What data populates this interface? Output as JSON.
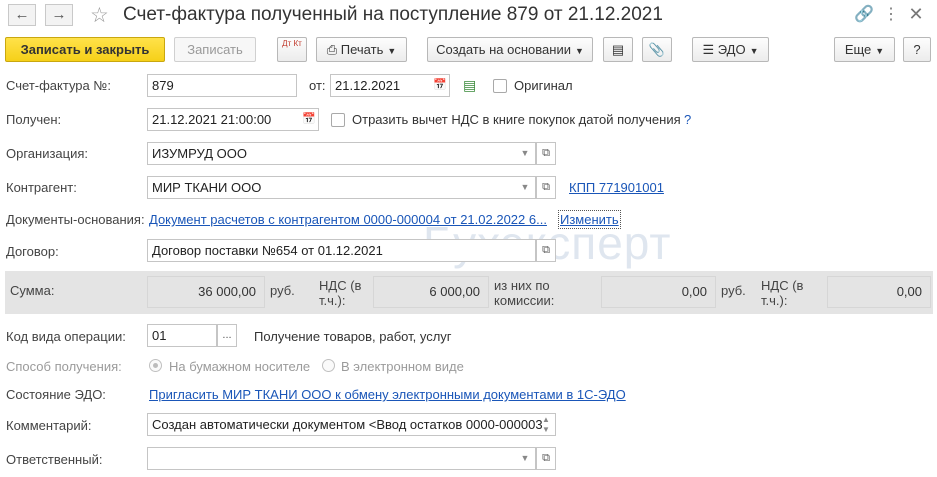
{
  "window": {
    "title": "Счет-фактура полученный на поступление 879 от 21.12.2021",
    "icons": [
      "back-arrow-icon",
      "forward-arrow-icon",
      "star-icon",
      "link-icon",
      "more-icon",
      "close-icon"
    ]
  },
  "toolbar": {
    "save_close": "Записать и закрыть",
    "save": "Записать",
    "dt_kt": "Дт Кт",
    "print": "Печать",
    "create_based": "Создать на основании",
    "edo": "ЭДО",
    "more": "Еще",
    "help": "?"
  },
  "form": {
    "invoice_no_label": "Счет-фактура №:",
    "invoice_no": "879",
    "from_label": "от:",
    "from_date": "21.12.2021",
    "original_label": "Оригинал",
    "received_label": "Получен:",
    "received": "21.12.2021 21:00:00",
    "vat_deduct_label": "Отразить вычет НДС в книге покупок датой получения",
    "vat_help": "?",
    "org_label": "Организация:",
    "org": "ИЗУМРУД ООО",
    "contractor_label": "Контрагент:",
    "contractor": "МИР ТКАНИ ООО",
    "kpp_link": "КПП 771901001",
    "basis_label": "Документы-основания:",
    "basis_link": "Документ расчетов с контрагентом 0000-000004 от 21.02.2022 6...",
    "change_link": "Изменить",
    "contract_label": "Договор:",
    "contract": "Договор поставки №654 от 01.12.2021",
    "op_code_label": "Код вида операции:",
    "op_code": "01",
    "op_code_desc": "Получение товаров, работ, услуг",
    "method_label": "Способ получения:",
    "method_paper": "На бумажном носителе",
    "method_electronic": "В электронном виде",
    "edo_state_label": "Состояние ЭДО:",
    "edo_invite_link": "Пригласить МИР ТКАНИ ООО к обмену электронными документами в 1С-ЭДО",
    "comment_label": "Комментарий:",
    "comment": "Создан автоматически документом <Ввод остатков 0000-000003",
    "responsible_label": "Ответственный:",
    "responsible": ""
  },
  "sums": {
    "sum_label": "Сумма:",
    "sum": "36 000,00",
    "currency1": "руб.",
    "vat_label_1": "НДС (в",
    "vat_label_2": "т.ч.):",
    "vat": "6 000,00",
    "commission_label_1": "из них по",
    "commission_label_2": "комиссии:",
    "commission": "0,00",
    "currency2": "руб.",
    "vat2_label_1": "НДС (в",
    "vat2_label_2": "т.ч.):",
    "vat2": "0,00"
  },
  "watermark": "Бухэксперт"
}
